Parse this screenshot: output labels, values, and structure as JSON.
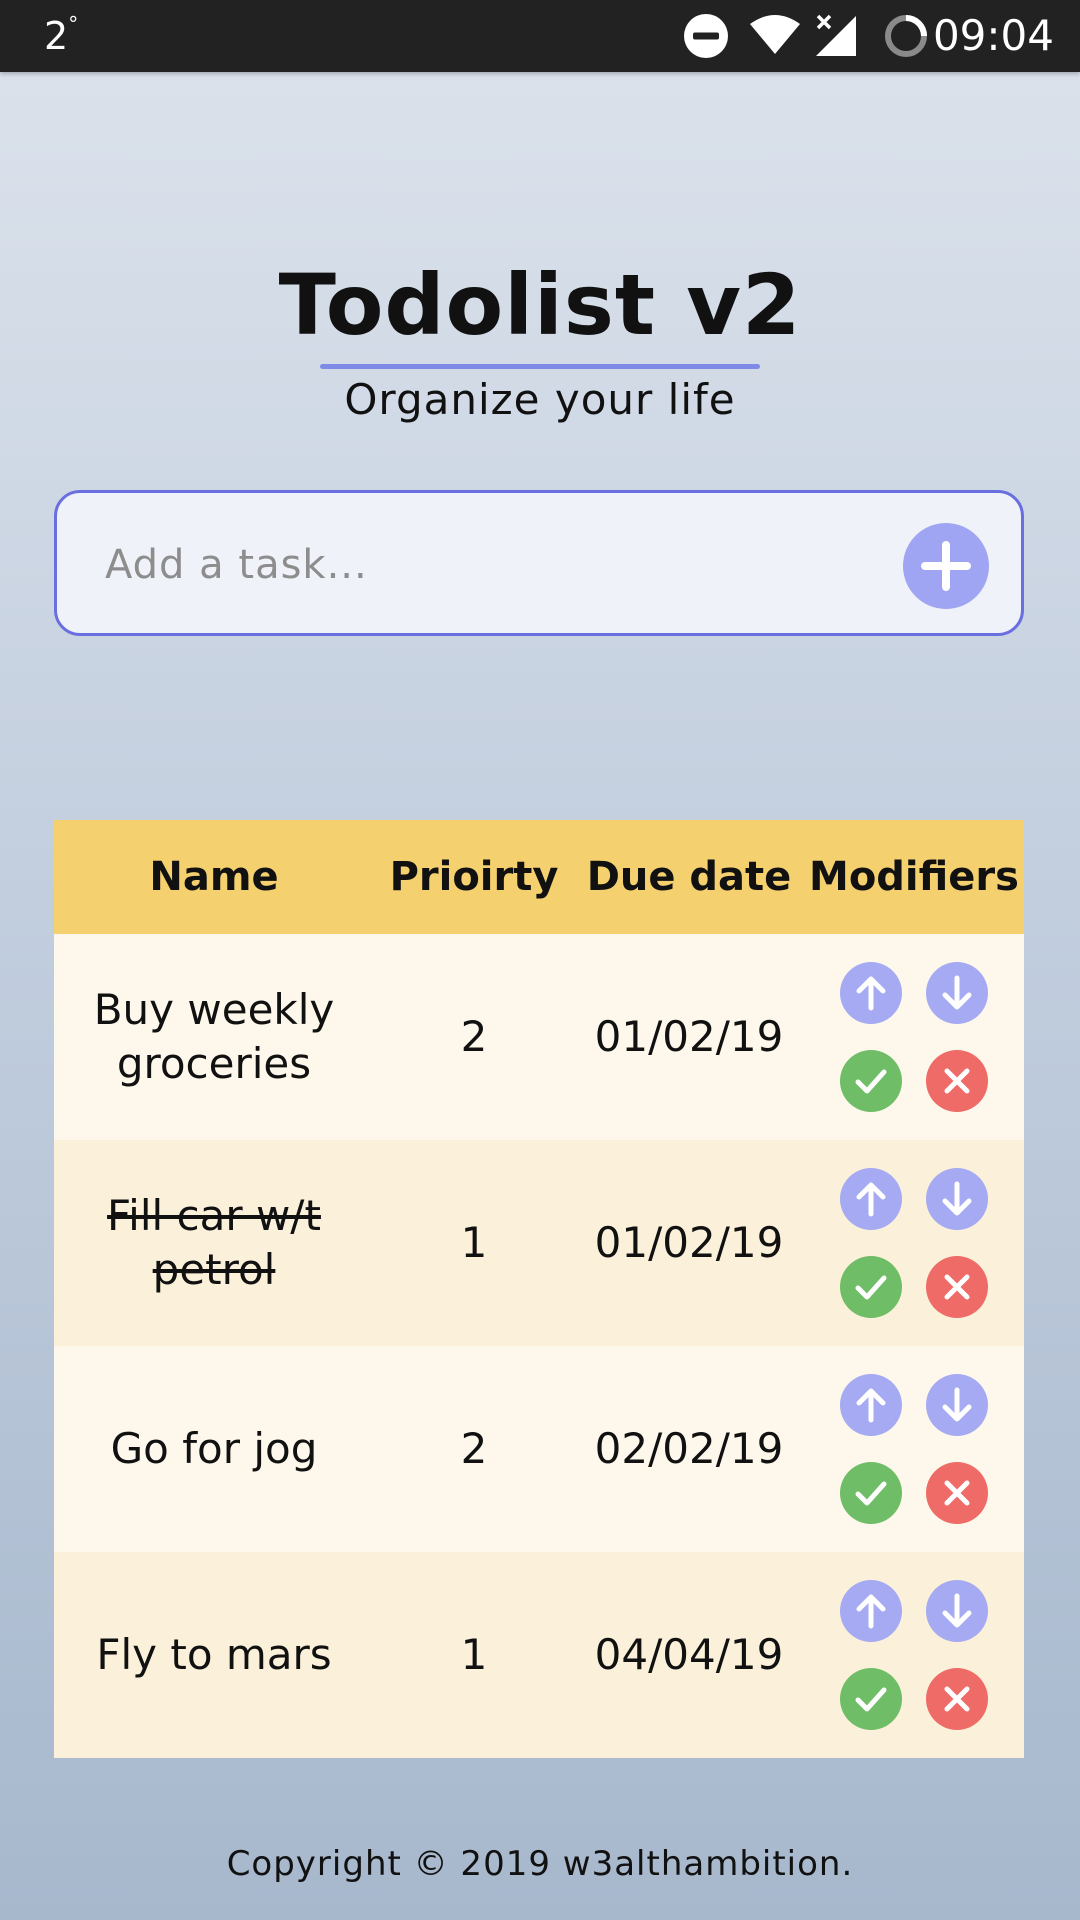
{
  "status_bar": {
    "left_indicator": "2",
    "left_sup": "°",
    "time": "09:04",
    "icons": [
      "do-not-disturb-icon",
      "wifi-icon",
      "no-signal-icon",
      "sync-icon"
    ]
  },
  "header": {
    "title": "Todolist v2",
    "subtitle": "Organize your life"
  },
  "task_input": {
    "placeholder": "Add a task...",
    "value": ""
  },
  "table": {
    "headers": {
      "name": "Name",
      "priority": "Prioirty",
      "due": "Due date",
      "modifiers": "Modifiers"
    },
    "rows": [
      {
        "name": "Buy weekly groceries",
        "priority": "2",
        "due": "01/02/19",
        "completed": false
      },
      {
        "name": "Fill car w/t petrol",
        "priority": "1",
        "due": "01/02/19",
        "completed": true
      },
      {
        "name": "Go for jog",
        "priority": "2",
        "due": "02/02/19",
        "completed": false
      },
      {
        "name": "Fly to mars",
        "priority": "1",
        "due": "04/04/19",
        "completed": false
      }
    ]
  },
  "footer": {
    "copyright": "Copyright © 2019 w3althambition."
  },
  "colors": {
    "accent": "#6a6fe0",
    "table_header": "#f5d06f",
    "arrow_button": "#a5aaf2",
    "complete_button": "#6fbd66",
    "delete_button": "#ef6b67"
  }
}
